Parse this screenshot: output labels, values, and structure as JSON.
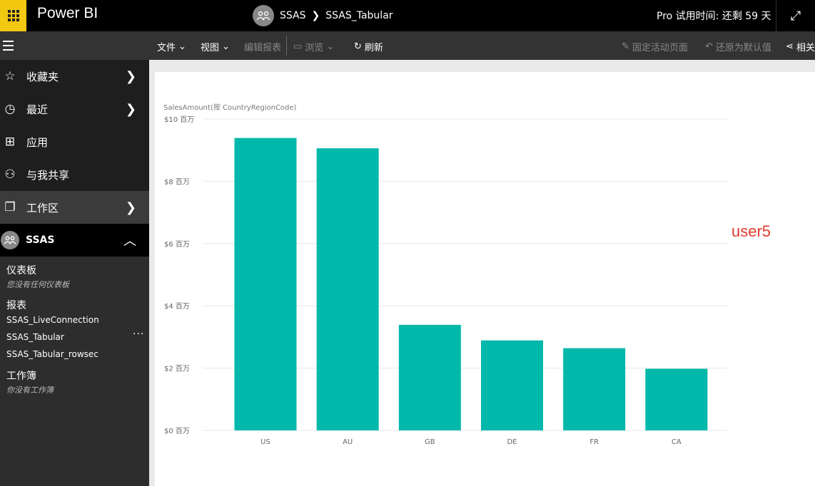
{
  "topbar": {
    "app_name": "Power BI",
    "breadcrumb": {
      "workspace": "SSAS",
      "report": "SSAS_Tabular"
    },
    "trial_text": "Pro 试用时间: 还剩 59 天"
  },
  "actionbar": {
    "file": "文件",
    "view": "视图",
    "edit_report": "编辑报表",
    "explore": "浏览",
    "refresh": "刷新",
    "pin_live_page": "固定活动页面",
    "reset_default": "还原为默认值",
    "related": "相关"
  },
  "sidebar": {
    "favorites": "收藏夹",
    "recent": "最近",
    "apps": "应用",
    "shared_with_me": "与我共享",
    "workspaces": "工作区",
    "workspace_name": "SSAS",
    "dashboards_title": "仪表板",
    "dashboards_empty": "您没有任何仪表板",
    "reports_title": "报表",
    "reports": [
      "SSAS_LiveConnection",
      "SSAS_Tabular",
      "SSAS_Tabular_rowsec"
    ],
    "workbooks_title": "工作簿",
    "workbooks_empty": "你没有工作簿"
  },
  "annotation": "user5",
  "colors": {
    "accent": "#f2c811",
    "bar": "#01b8aa",
    "annotation": "#e23b2e"
  },
  "chart_data": {
    "type": "bar",
    "title": "SalesAmount(按 CountryRegionCode)",
    "categories": [
      "US",
      "AU",
      "GB",
      "DE",
      "FR",
      "CA"
    ],
    "values": [
      9.39,
      9.06,
      3.39,
      2.89,
      2.64,
      1.98
    ],
    "ylim": [
      0,
      10
    ],
    "yticks": [
      "$0 百万",
      "$2 百万",
      "$4 百万",
      "$6 百万",
      "$8 百万",
      "$10 百万"
    ],
    "grid": true
  }
}
